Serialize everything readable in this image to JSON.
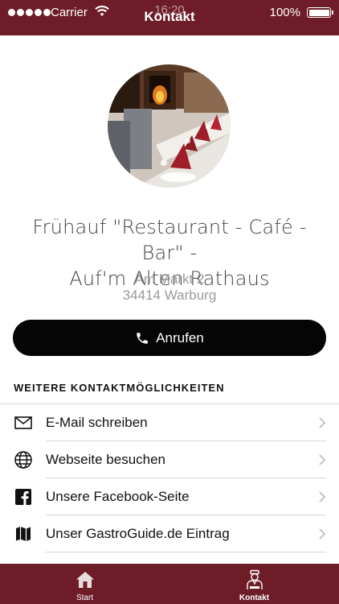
{
  "status_bar": {
    "carrier": "Carrier",
    "time": "16:20",
    "battery": "100%"
  },
  "nav": {
    "title": "Kontakt"
  },
  "restaurant": {
    "name_line1": "Frühauf \"Restaurant - Café - Bar\" -",
    "name_line2": "Auf'm Alten Rathaus",
    "address_line1": "Am Markt 2",
    "address_line2": "34414 Warburg"
  },
  "call_button": {
    "label": "Anrufen",
    "icon": "phone-icon"
  },
  "contact": {
    "section_title": "WEITERE KONTAKTMÖGLICHKEITEN",
    "items": [
      {
        "label": "E-Mail schreiben",
        "icon": "envelope-icon"
      },
      {
        "label": "Webseite besuchen",
        "icon": "globe-icon"
      },
      {
        "label": "Unsere Facebook-Seite",
        "icon": "facebook-icon"
      },
      {
        "label": "Unser GastroGuide.de Eintrag",
        "icon": "map-icon"
      }
    ]
  },
  "tabbar": {
    "tabs": [
      {
        "label": "Start",
        "icon": "home-icon"
      },
      {
        "label": "Kontakt",
        "icon": "waiter-icon",
        "active": true
      }
    ]
  },
  "colors": {
    "brand": "#6e1d28",
    "button": "#050505",
    "address_text": "#9a9a9a"
  }
}
